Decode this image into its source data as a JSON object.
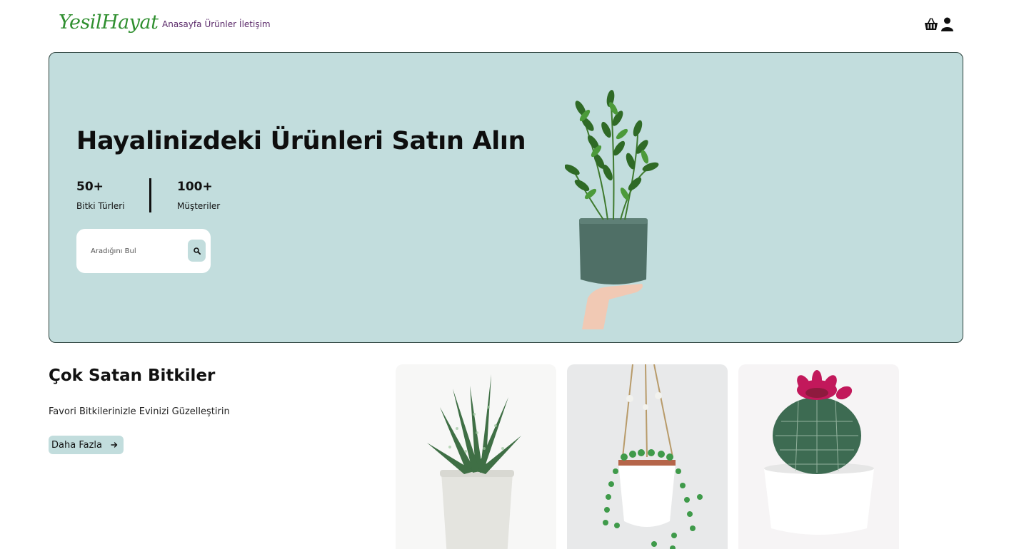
{
  "header": {
    "logo": "YesilHayat",
    "nav": [
      "Anasayfa",
      "Ürünler",
      "İletişim"
    ],
    "icons": [
      "basket-icon",
      "user-icon"
    ]
  },
  "hero": {
    "title": "Hayalinizdeki Ürünleri Satın Alın",
    "stats": [
      {
        "value": "50+",
        "label": "Bitki Türleri"
      },
      {
        "value": "100+",
        "label": "Müşteriler"
      }
    ],
    "search": {
      "placeholder": "Aradığını Bul",
      "value": ""
    }
  },
  "best_sellers": {
    "title": "Çok Satan Bitkiler",
    "subtitle": "Favori Bitkilerinizle Evinizi Güzelleştirin",
    "button_label": "Daha Fazla"
  },
  "colors": {
    "accent": "#c2dddd",
    "logo_green": "#2f8f2f",
    "nav_purple": "#5b2a6a"
  }
}
